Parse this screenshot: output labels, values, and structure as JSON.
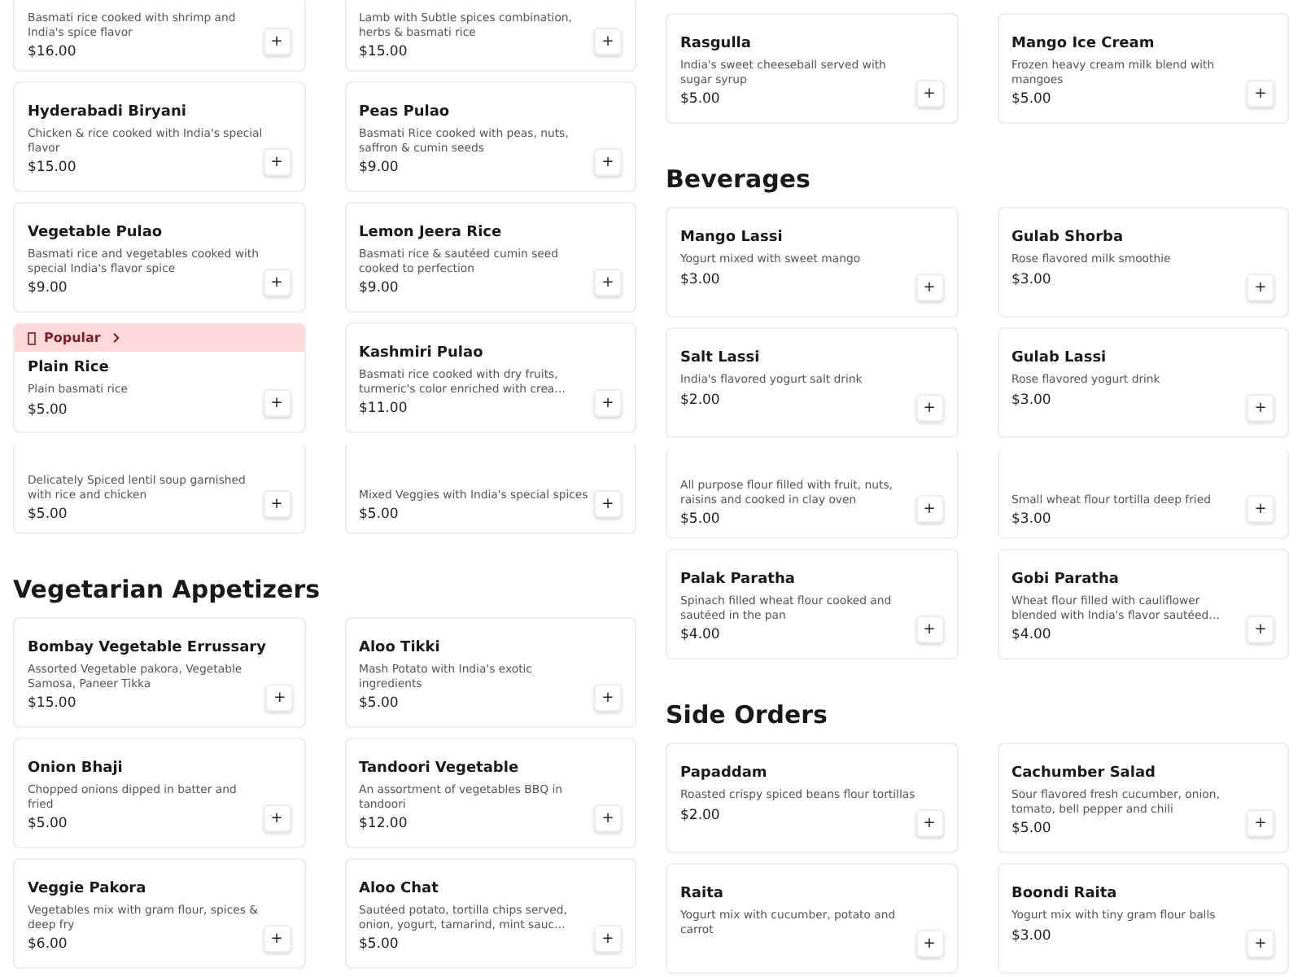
{
  "columns": [
    {
      "sections": [
        {
          "items": [
            {
              "kind": "cut",
              "description": "Basmati rice cooked with shrimp and India's spice flavor",
              "price": "$16.00",
              "button": "+"
            },
            {
              "kind": "cut",
              "description": "Lamb with Subtle spices combination, herbs & basmati rice",
              "price": "$15.00",
              "button": "+"
            },
            {
              "kind": "full",
              "name": "Hyderabadi Biryani",
              "description": "Chicken & rice cooked with India's special flavor",
              "price": "$15.00",
              "button": "+"
            },
            {
              "kind": "full",
              "name": "Peas Pulao",
              "description": "Basmati Rice cooked with peas, nuts, saffron & cumin seeds",
              "price": "$9.00",
              "button": "+"
            },
            {
              "kind": "full",
              "name": "Vegetable Pulao",
              "description": "Basmati rice and vegetables cooked with special India's flavor spice",
              "price": "$9.00",
              "button": "+"
            },
            {
              "kind": "full",
              "name": "Lemon Jeera Rice",
              "description": "Basmati rice & sautéed cumin seed cooked to perfection",
              "price": "$9.00",
              "button": "+"
            },
            {
              "kind": "full",
              "badge": "Popular",
              "name": "Plain Rice",
              "description": "Plain basmati rice",
              "price": "$5.00",
              "button": "+"
            },
            {
              "kind": "full",
              "name": "Kashmiri Pulao",
              "description": "Basmati rice cooked with dry fruits, turmeric's color enriched with crea…",
              "price": "$11.00",
              "button": "+"
            },
            {
              "kind": "partial",
              "description": "Delicately Spiced lentil soup garnished with rice and chicken",
              "price": "$5.00",
              "button": "+"
            },
            {
              "kind": "partial",
              "description": "Mixed Veggies with India's special spices",
              "price": "$5.00",
              "button": "+"
            }
          ]
        },
        {
          "heading": "Vegetarian Appetizers",
          "items": [
            {
              "kind": "full",
              "name": "Bombay Vegetable Errussary",
              "description": "Assorted Vegetable pakora, Vegetable Samosa, Paneer Tikka",
              "price": "$15.00",
              "button": "+"
            },
            {
              "kind": "full",
              "name": "Aloo Tikki",
              "description": "Mash Potato with India's exotic ingredients",
              "price": "$5.00",
              "button": "+"
            },
            {
              "kind": "full",
              "name": "Onion Bhaji",
              "description": "Chopped onions dipped in batter and fried",
              "price": "$5.00",
              "button": "+"
            },
            {
              "kind": "full",
              "name": "Tandoori Vegetable",
              "description": "An assortment of vegetables BBQ in tandoori",
              "price": "$12.00",
              "button": "+"
            },
            {
              "kind": "full",
              "name": "Veggie Pakora",
              "description": "Vegetables mix with gram flour, spices & deep fry",
              "price": "$6.00",
              "button": "+"
            },
            {
              "kind": "full",
              "name": "Aloo Chat",
              "description": "Sautéed potato, tortilla chips served, onion, yogurt, tamarind, mint sauc…",
              "price": "$5.00",
              "button": "+"
            }
          ]
        }
      ]
    },
    {
      "sections": [
        {
          "items": [
            {
              "kind": "full",
              "name": "Rasgulla",
              "description": "India's sweet cheeseball served with sugar syrup",
              "price": "$5.00",
              "button": "+"
            },
            {
              "kind": "full",
              "name": "Mango Ice Cream",
              "description": "Frozen heavy cream milk blend with mangoes",
              "price": "$5.00",
              "button": "+"
            }
          ]
        },
        {
          "heading": "Beverages",
          "items": [
            {
              "kind": "full",
              "name": "Mango Lassi",
              "description": "Yogurt mixed with sweet mango",
              "price": "$3.00",
              "button": "+"
            },
            {
              "kind": "full",
              "name": "Gulab Shorba",
              "description": "Rose flavored milk smoothie",
              "price": "$3.00",
              "button": "+"
            },
            {
              "kind": "full",
              "name": "Salt Lassi",
              "description": "India's flavored yogurt salt drink",
              "price": "$2.00",
              "button": "+"
            },
            {
              "kind": "full",
              "name": "Gulab Lassi",
              "description": "Rose flavored yogurt drink",
              "price": "$3.00",
              "button": "+"
            },
            {
              "kind": "partial",
              "description": "All purpose flour filled with fruit, nuts, raisins and cooked in clay oven",
              "price": "$5.00",
              "button": "+"
            },
            {
              "kind": "partial",
              "description": "Small wheat flour tortilla deep fried",
              "price": "$3.00",
              "button": "+"
            },
            {
              "kind": "full",
              "name": "Palak Paratha",
              "description": "Spinach filled wheat flour cooked and sautéed in the pan",
              "price": "$4.00",
              "button": "+"
            },
            {
              "kind": "full",
              "name": "Gobi Paratha",
              "description": "Wheat flour filled with cauliflower blended with India's flavor sautéed…",
              "price": "$4.00",
              "button": "+"
            }
          ]
        },
        {
          "heading": "Side Orders",
          "items": [
            {
              "kind": "full",
              "name": "Papaddam",
              "description": "Roasted crispy spiced beans flour tortillas",
              "price": "$2.00",
              "button": "+"
            },
            {
              "kind": "full",
              "name": "Cachumber Salad",
              "description": "Sour flavored fresh cucumber, onion, tomato, bell pepper and chili",
              "price": "$5.00",
              "button": "+"
            },
            {
              "kind": "full",
              "name": "Raita",
              "description": "Yogurt mix with cucumber, potato and carrot",
              "button": "+"
            },
            {
              "kind": "full",
              "name": "Boondi Raita",
              "description": "Yogurt mix with tiny gram flour balls",
              "price": "$3.00",
              "button": "+"
            }
          ]
        }
      ]
    }
  ]
}
